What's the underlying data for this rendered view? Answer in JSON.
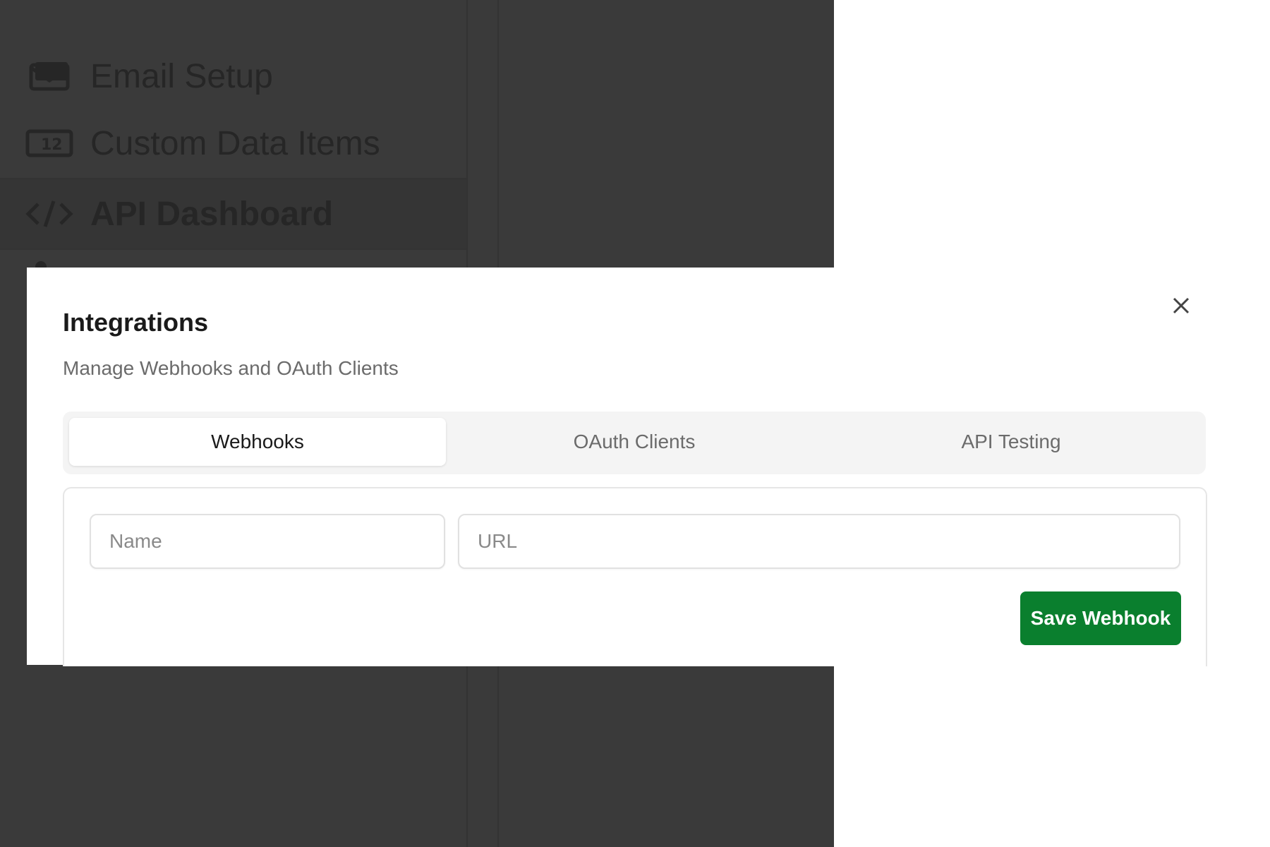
{
  "sidebar": {
    "items": [
      {
        "label": "Email Setup",
        "icon": "envelope-icon"
      },
      {
        "label": "Custom Data Items",
        "icon": "number-box-icon",
        "icon_text": "12"
      },
      {
        "label": "API Dashboard",
        "icon": "code-icon",
        "active": true
      }
    ]
  },
  "modal": {
    "title": "Integrations",
    "subtitle": "Manage Webhooks and OAuth Clients",
    "close_icon": "close-icon",
    "tabs": [
      {
        "label": "Webhooks",
        "active": true
      },
      {
        "label": "OAuth Clients",
        "active": false
      },
      {
        "label": "API Testing",
        "active": false
      }
    ],
    "form": {
      "name_placeholder": "Name",
      "name_value": "",
      "url_placeholder": "URL",
      "url_value": "",
      "save_label": "Save Webhook"
    }
  },
  "colors": {
    "overlay": "#3a3a3a",
    "accent": "#0a7f2e",
    "tab_bar": "#f4f4f4"
  }
}
